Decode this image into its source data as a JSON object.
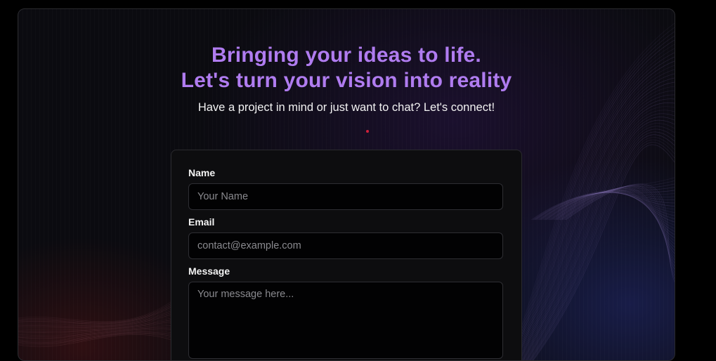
{
  "header": {
    "title_line1": "Bringing your ideas to life.",
    "title_line2": "Let's turn your vision into reality",
    "subtitle": "Have a project in mind or just want to chat? Let's connect!"
  },
  "form": {
    "name": {
      "label": "Name",
      "placeholder": "Your Name",
      "value": ""
    },
    "email": {
      "label": "Email",
      "placeholder": "contact@example.com",
      "value": ""
    },
    "message": {
      "label": "Message",
      "placeholder": "Your message here...",
      "value": ""
    }
  },
  "colors": {
    "accent": "#b07cf0",
    "page_background": "#000000",
    "card_background": "#0b0b10",
    "form_background": "#0d0d0f",
    "indicator_dot": "#d0203a"
  },
  "icons": {
    "indicator": "red-dot"
  }
}
